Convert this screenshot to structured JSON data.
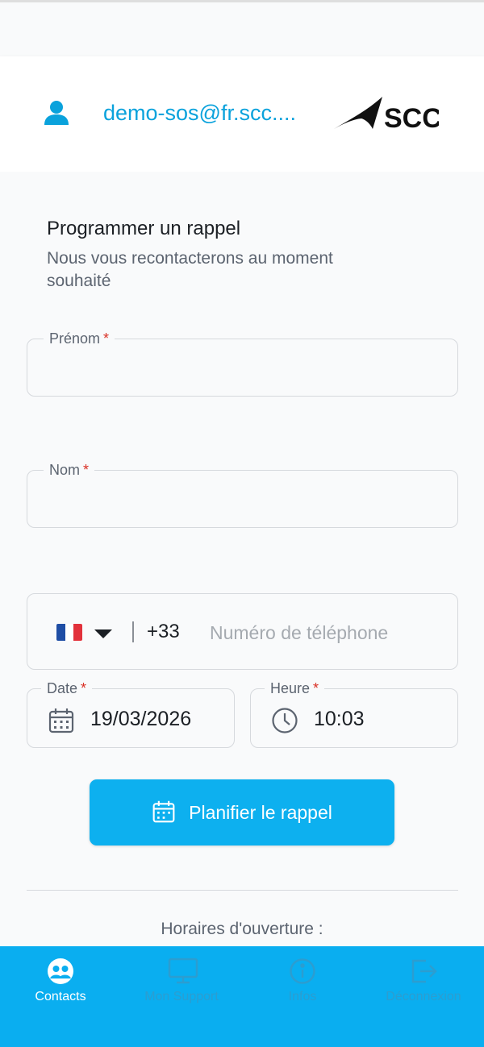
{
  "header": {
    "email": "demo-sos@fr.scc....",
    "logo_text": "SCC"
  },
  "form": {
    "title": "Programmer un rappel",
    "subtitle": "Nous vous recontacterons au moment souhaité",
    "first_name": {
      "label": "Prénom",
      "required_mark": "*",
      "value": ""
    },
    "last_name": {
      "label": "Nom",
      "required_mark": "*",
      "value": ""
    },
    "phone": {
      "country_flag": "france-flag",
      "dial_code": "+33",
      "placeholder": "Numéro de téléphone",
      "value": ""
    },
    "date": {
      "label": "Date",
      "required_mark": "*",
      "value": "19/03/2026"
    },
    "time": {
      "label": "Heure",
      "required_mark": "*",
      "value": "10:03"
    },
    "submit_label": "Planifier le rappel"
  },
  "hours_heading": "Horaires d'ouverture :",
  "tabs": [
    {
      "label": "Contacts",
      "icon": "contacts-icon",
      "active": true
    },
    {
      "label": "Mon Support",
      "icon": "monitor-icon",
      "active": false
    },
    {
      "label": "Infos",
      "icon": "info-icon",
      "active": false
    },
    {
      "label": "Déconnexion",
      "icon": "logout-icon",
      "active": false
    }
  ],
  "colors": {
    "accent": "#0aa2dc",
    "button": "#0db0ef",
    "tabbar": "#0aaef0",
    "required": "#d93025"
  }
}
